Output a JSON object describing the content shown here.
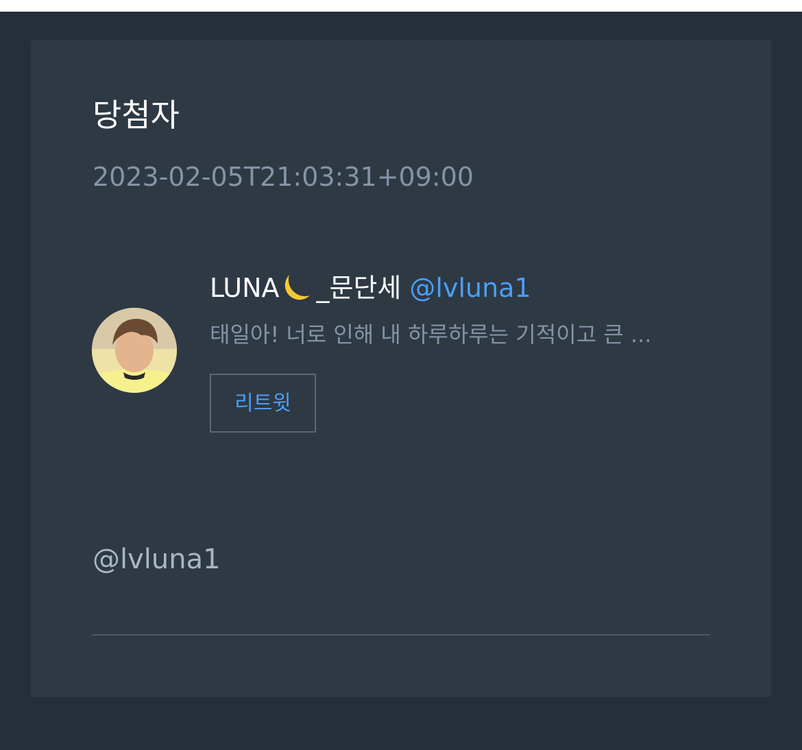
{
  "title": "당첨자",
  "timestamp": "2023-02-05T21:03:31+09:00",
  "tweet": {
    "display_name": "LUNA",
    "display_name_suffix": "_문단세",
    "name_emoji": "moon-icon",
    "handle": "@lvluna1",
    "text": "태일아! 너로 인해 내 하루하루는 기적이고 큰 ...",
    "retweet_label": "리트윗"
  },
  "winner_handle": "@lvluna1",
  "colors": {
    "background": "#252f39",
    "card": "#2e3944",
    "link": "#4a9ff5",
    "muted": "#8494a6"
  }
}
